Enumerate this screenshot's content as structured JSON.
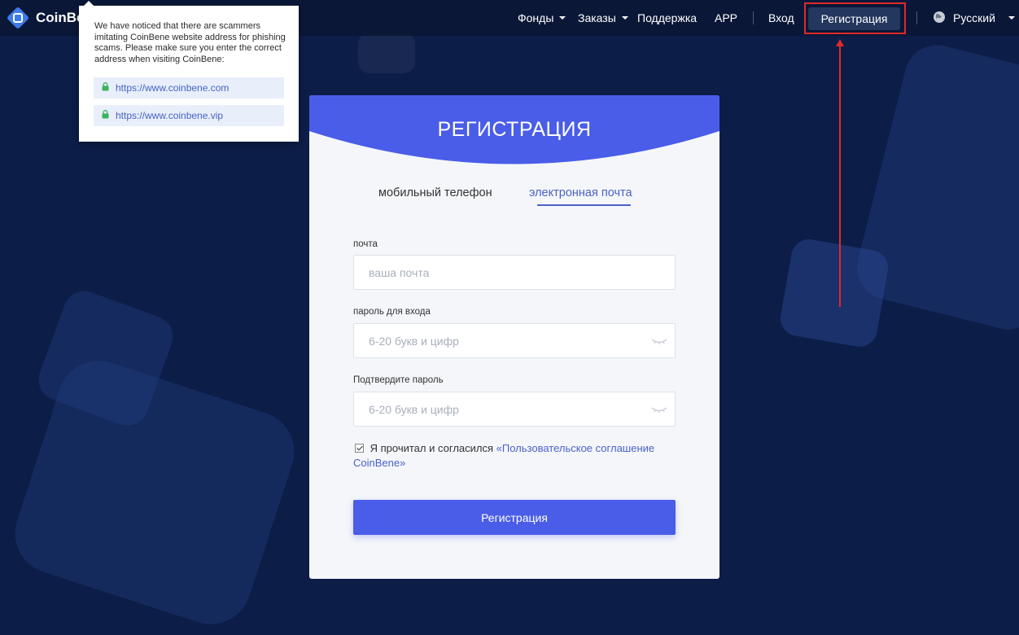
{
  "header": {
    "logo_text": "CoinBene",
    "nav": {
      "funds": "Фонды",
      "orders": "Заказы",
      "support": "Поддержка",
      "app": "APP",
      "login": "Вход",
      "register": "Регистрация",
      "language": "Русский"
    }
  },
  "popup": {
    "message": "We have noticed that there are scammers imitating CoinBene website address for phishing scams. Please make sure you enter the correct address when visiting CoinBene:",
    "links": [
      "https://www.coinbene.com",
      "https://www.coinbene.vip"
    ]
  },
  "card": {
    "title": "РЕГИСТРАЦИЯ",
    "tabs": {
      "phone": "мобильный телефон",
      "email": "электронная почта"
    },
    "fields": {
      "email_label": "почта",
      "email_placeholder": "ваша почта",
      "password_label": "пароль для входа",
      "password_placeholder": "6-20 букв и цифр",
      "confirm_label": "Подтвердите пароль",
      "confirm_placeholder": "6-20 букв и цифр"
    },
    "agree_text": "Я прочитал и согласился",
    "agree_link": "«Пользовательское соглашение CoinBene»",
    "submit": "Регистрация"
  },
  "colors": {
    "background": "#0c1d47",
    "header": "#0a1737",
    "accent": "#4a5de8",
    "highlight": "#e02a2a"
  }
}
